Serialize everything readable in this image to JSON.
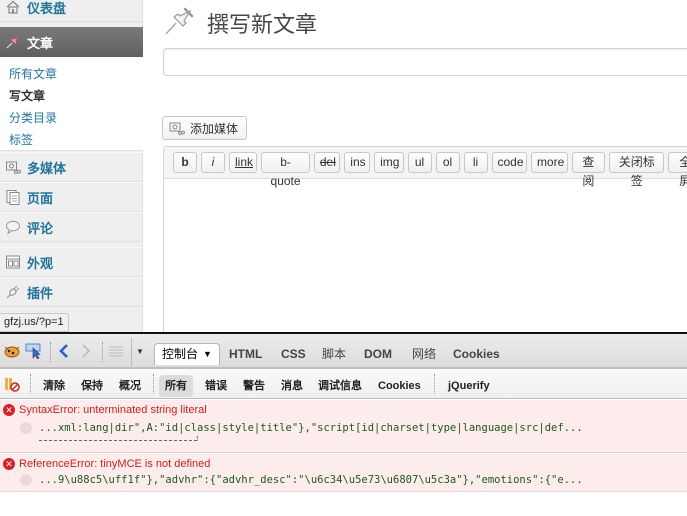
{
  "sidebar": {
    "dashboard": {
      "label": "仪表盘",
      "icon": "home-icon"
    },
    "posts": {
      "label": "文章",
      "icon": "pushpin-icon"
    },
    "posts_submenu": [
      {
        "label": "所有文章",
        "current": false
      },
      {
        "label": "写文章",
        "current": true
      },
      {
        "label": "分类目录",
        "current": false
      },
      {
        "label": "标签",
        "current": false
      }
    ],
    "items": [
      {
        "label": "多媒体",
        "icon": "media-icon"
      },
      {
        "label": "页面",
        "icon": "pages-icon"
      },
      {
        "label": "评论",
        "icon": "comment-icon"
      },
      {
        "label": "外观",
        "icon": "appearance-icon"
      },
      {
        "label": "插件",
        "icon": "plugin-icon"
      }
    ],
    "status_url": "gfzj.us/?p=1"
  },
  "main": {
    "page_title": "撰写新文章",
    "title_input": {
      "value": "",
      "placeholder": ""
    },
    "add_media_label": "添加媒体",
    "quicktags": [
      "b",
      "i",
      "link",
      "b-quote",
      "del",
      "ins",
      "img",
      "ul",
      "ol",
      "li",
      "code",
      "more",
      "查阅",
      "关闭标签",
      "全屏"
    ]
  },
  "firebug": {
    "console_tab": "控制台",
    "tabs": [
      "HTML",
      "CSS",
      "脚本",
      "DOM",
      "网络",
      "Cookies"
    ],
    "actions": [
      "清除",
      "保持",
      "概况"
    ],
    "filters": [
      "所有",
      "错误",
      "警告",
      "消息",
      "调试信息",
      "Cookies"
    ],
    "selected_filter": "所有",
    "extra_tab": "jQuerify",
    "errors": [
      {
        "message": "SyntaxError: unterminated string literal",
        "source": "...xml:lang|dir\",A:\"id|class|style|title\"},\"script[id|charset|type|language|src|def..."
      },
      {
        "message": "ReferenceError: tinyMCE is not defined",
        "source": "...9\\u88c5\\uff1f\"},\"advhr\":{\"advhr_desc\":\"\\u6c34\\u5e73\\u6807\\u5c3a\"},\"emotions\":{\"e..."
      }
    ]
  },
  "colors": {
    "link": "#21759b",
    "active_menu": "#6a6a6a",
    "error_text": "#d21b1b",
    "error_bg": "#fdecec",
    "source_text": "#1a5a1a"
  }
}
